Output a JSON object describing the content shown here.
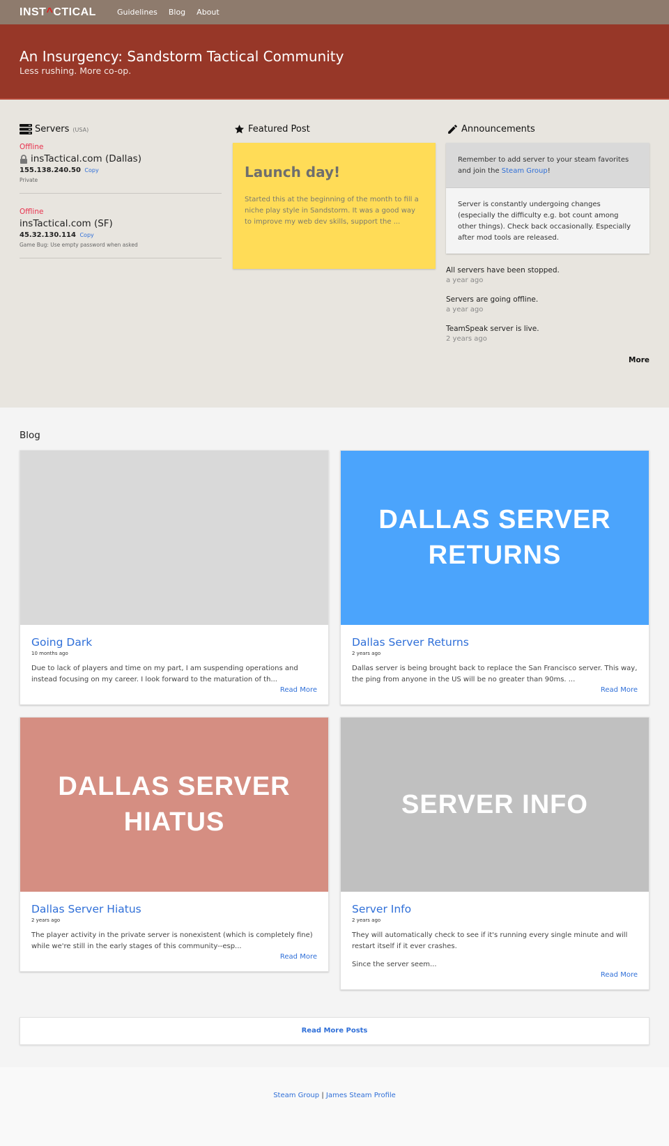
{
  "nav": {
    "logo_left": "INST",
    "logo_mark": "^",
    "logo_right": "CTICAL",
    "links": [
      "Guidelines",
      "Blog",
      "About"
    ]
  },
  "hero": {
    "title": "An Insurgency: Sandstorm Tactical Community",
    "subtitle": "Less rushing. More co-op."
  },
  "servers": {
    "heading": "Servers",
    "region": "(USA)",
    "icon": "server-icon",
    "items": [
      {
        "status": "Offline",
        "locked": true,
        "name": "insTactical.com (Dallas)",
        "ip": "155.138.240.50",
        "copy": "Copy",
        "note": "Private"
      },
      {
        "status": "Offline",
        "locked": false,
        "name": "insTactical.com (SF)",
        "ip": "45.32.130.114",
        "copy": "Copy",
        "note": "Game Bug: Use empty password when asked"
      }
    ]
  },
  "featured": {
    "heading": "Featured Post",
    "icon": "star-icon",
    "title": "Launch day!",
    "excerpt": "Started this at the beginning of the month to fill a niche play style in Sandstorm. It was a good way to improve my web dev skills, support the ..."
  },
  "announcements": {
    "heading": "Announcements",
    "icon": "pencil-icon",
    "pinned_prefix": "Remember to add server to your steam favorites and join the ",
    "pinned_link": "Steam Group",
    "pinned_suffix": "!",
    "notice": "Server is constantly undergoing changes (especially the difficulty e.g. bot count among other things). Check back occasionally. Especially after mod tools are released.",
    "items": [
      {
        "text": "All servers have been stopped.",
        "time": "a year ago"
      },
      {
        "text": "Servers are going offline.",
        "time": "a year ago"
      },
      {
        "text": "TeamSpeak server is live.",
        "time": "2 years ago"
      }
    ],
    "more": "More"
  },
  "blog": {
    "heading": "Blog",
    "posts": [
      {
        "image_text": "",
        "image_color": "#d9d9d9",
        "title": "Going Dark",
        "date": "10 months ago",
        "paragraphs": [
          "Due to lack of players and time on my part, I am suspending operations and instead focusing on my career. I look forward to the maturation of th..."
        ],
        "read_more": "Read More"
      },
      {
        "image_text": "DALLAS SERVER RETURNS",
        "image_color": "#4ba4fc",
        "title": "Dallas Server Returns",
        "date": "2 years ago",
        "paragraphs": [
          "Dallas server is being brought back to replace the San Francisco server. This way, the ping from anyone in the US will be no greater than 90ms. ..."
        ],
        "read_more": "Read More"
      },
      {
        "image_text": "DALLAS SERVER HIATUS",
        "image_color": "#d58e82",
        "title": "Dallas Server Hiatus",
        "date": "2 years ago",
        "paragraphs": [
          "The player activity in the private server is nonexistent (which is completely fine) while we're still in the early stages of this community--esp..."
        ],
        "read_more": "Read More"
      },
      {
        "image_text": "SERVER INFO",
        "image_color": "#c0c0c0",
        "title": "Server Info",
        "date": "2 years ago",
        "paragraphs": [
          "They will automatically check to see if it's running every single minute and will restart itself if it ever crashes.",
          "Since the server seem..."
        ],
        "read_more": "Read More"
      }
    ],
    "more_posts": "Read More Posts"
  },
  "footer": {
    "links": [
      "Steam Group",
      "James Steam Profile"
    ],
    "separator": "|"
  },
  "colors": {
    "navbar": "#8e7b6d",
    "hero": "#973728",
    "link": "#2f6fd8",
    "offline": "#e8324e",
    "featured_bg": "#ffdc57"
  }
}
